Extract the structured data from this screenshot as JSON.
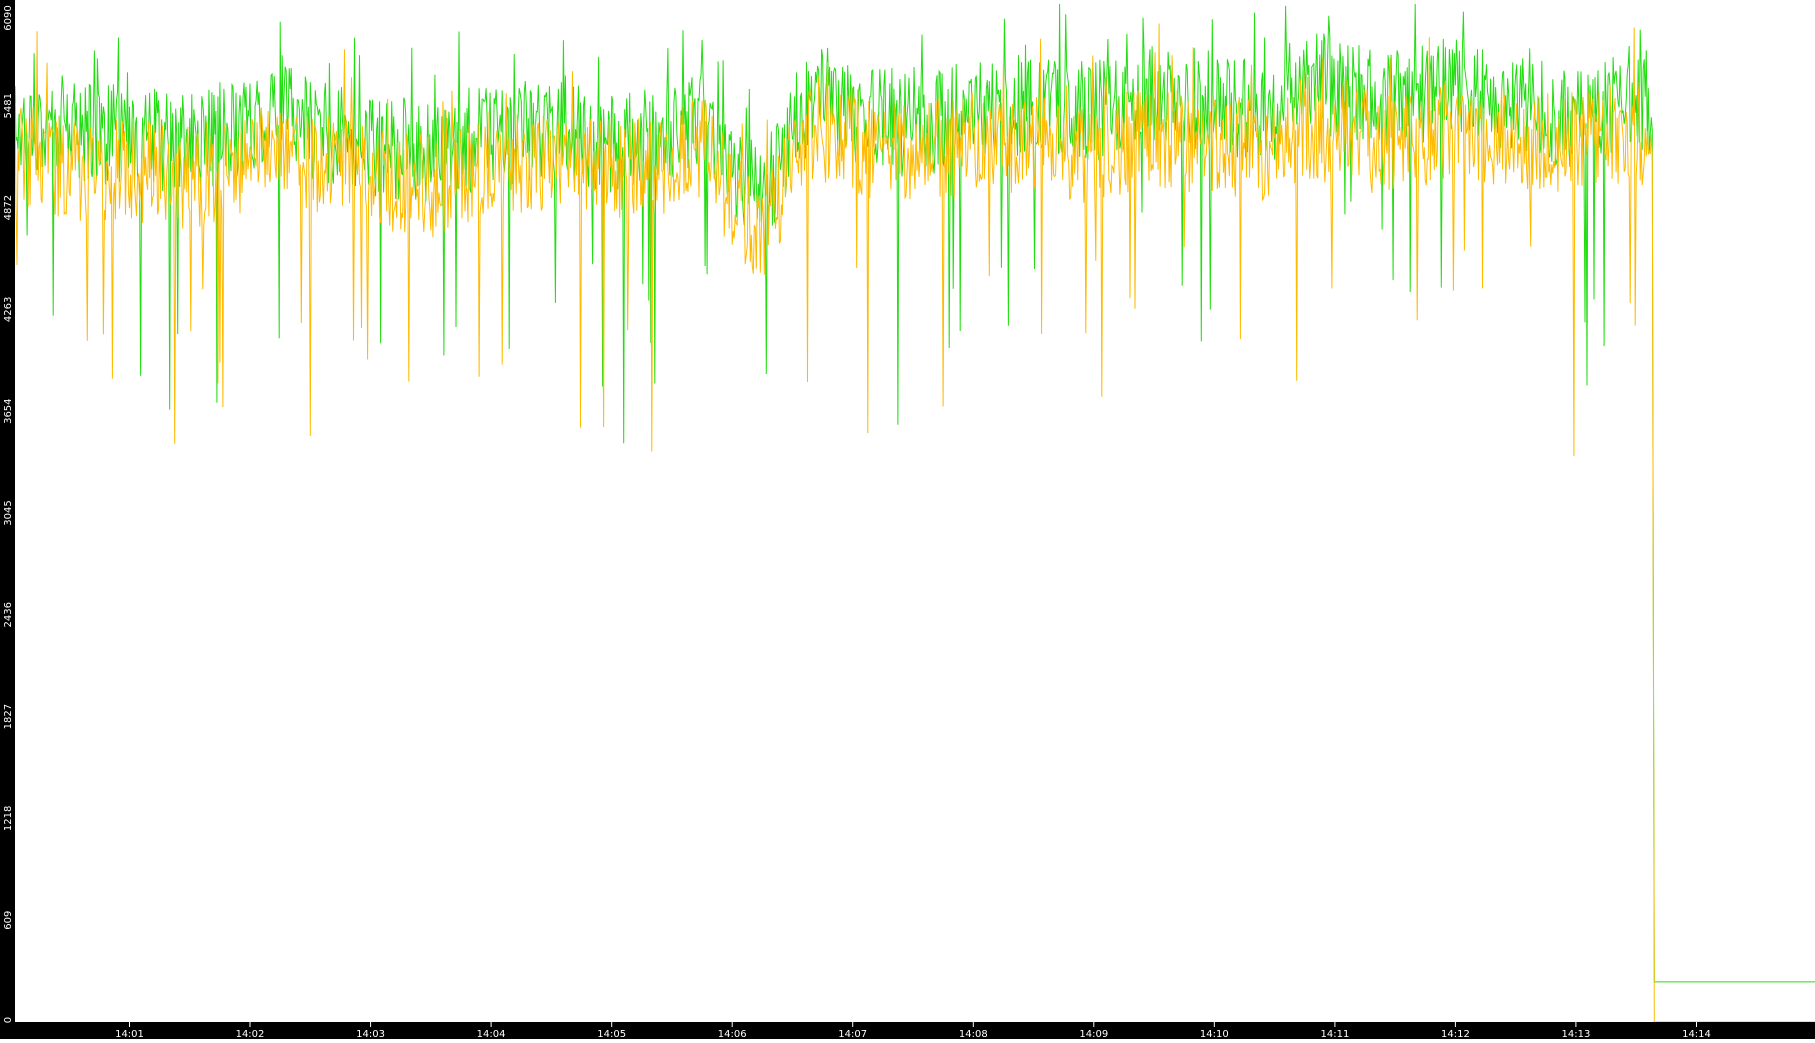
{
  "chart_data": {
    "type": "line",
    "title": "",
    "xlabel": "",
    "ylabel": "",
    "ylim": [
      0,
      6090
    ],
    "y_ticks": [
      "0",
      "609",
      "1218",
      "1827",
      "2436",
      "3045",
      "3654",
      "4263",
      "4872",
      "5481",
      "6090"
    ],
    "x_ticks": [
      "14:01",
      "14:02",
      "14:03",
      "14:04",
      "14:05",
      "14:06",
      "14:07",
      "14:08",
      "14:09",
      "14:10",
      "14:11",
      "14:12",
      "14:13",
      "14:14"
    ],
    "xlim": [
      "14:00:03",
      "14:14:59"
    ],
    "grid": false,
    "legend": "none",
    "colors": {
      "background": "#ffffff",
      "axis_band": "#000000",
      "axis_text": "#ffffff",
      "series_green": "#22dd11",
      "series_orange": "#ffbb00"
    },
    "series": [
      {
        "color": "#22dd11",
        "sampling": "1 point per second (smoothed envelope shown)",
        "time": [
          "14:00:03",
          "14:00:30",
          "14:01:00",
          "14:01:30",
          "14:02:00",
          "14:02:15",
          "14:02:30",
          "14:03:00",
          "14:03:30",
          "14:04:00",
          "14:04:30",
          "14:05:00",
          "14:05:30",
          "14:05:45",
          "14:06:00",
          "14:06:15",
          "14:06:30",
          "14:06:42",
          "14:07:00",
          "14:07:30",
          "14:08:00",
          "14:08:30",
          "14:09:00",
          "14:09:30",
          "14:10:00",
          "14:10:30",
          "14:10:45",
          "14:11:00",
          "14:11:30",
          "14:12:00",
          "14:12:30",
          "14:13:00",
          "14:13:30",
          "14:13:38",
          "14:13:39",
          "14:14:59"
        ],
        "values": [
          5400,
          5350,
          5300,
          5250,
          5380,
          5500,
          5350,
          5250,
          5200,
          5300,
          5350,
          5250,
          5300,
          5450,
          5100,
          4900,
          5350,
          5550,
          5450,
          5350,
          5450,
          5500,
          5450,
          5550,
          5500,
          5450,
          5650,
          5600,
          5500,
          5600,
          5500,
          5400,
          5550,
          5450,
          240,
          240
        ]
      },
      {
        "color": "#ffbb00",
        "sampling": "1 point per second (smoothed envelope shown)",
        "time": [
          "14:00:03",
          "14:00:30",
          "14:01:00",
          "14:01:30",
          "14:02:00",
          "14:02:15",
          "14:02:30",
          "14:03:00",
          "14:03:30",
          "14:04:00",
          "14:04:30",
          "14:05:00",
          "14:05:30",
          "14:05:45",
          "14:06:00",
          "14:06:15",
          "14:06:30",
          "14:06:42",
          "14:07:00",
          "14:07:30",
          "14:08:00",
          "14:08:30",
          "14:09:00",
          "14:09:30",
          "14:10:00",
          "14:10:30",
          "14:10:45",
          "14:11:00",
          "14:11:30",
          "14:12:00",
          "14:12:30",
          "14:13:00",
          "14:13:30",
          "14:13:38",
          "14:13:39",
          "14:14:59"
        ],
        "values": [
          5200,
          5100,
          5100,
          5050,
          5150,
          5300,
          5150,
          5050,
          5000,
          5150,
          5150,
          5100,
          5150,
          5250,
          4900,
          4700,
          5150,
          5350,
          5250,
          5200,
          5250,
          5250,
          5200,
          5300,
          5250,
          5200,
          5350,
          5300,
          5250,
          5350,
          5300,
          5250,
          5350,
          5250,
          0,
          0
        ]
      }
    ]
  }
}
